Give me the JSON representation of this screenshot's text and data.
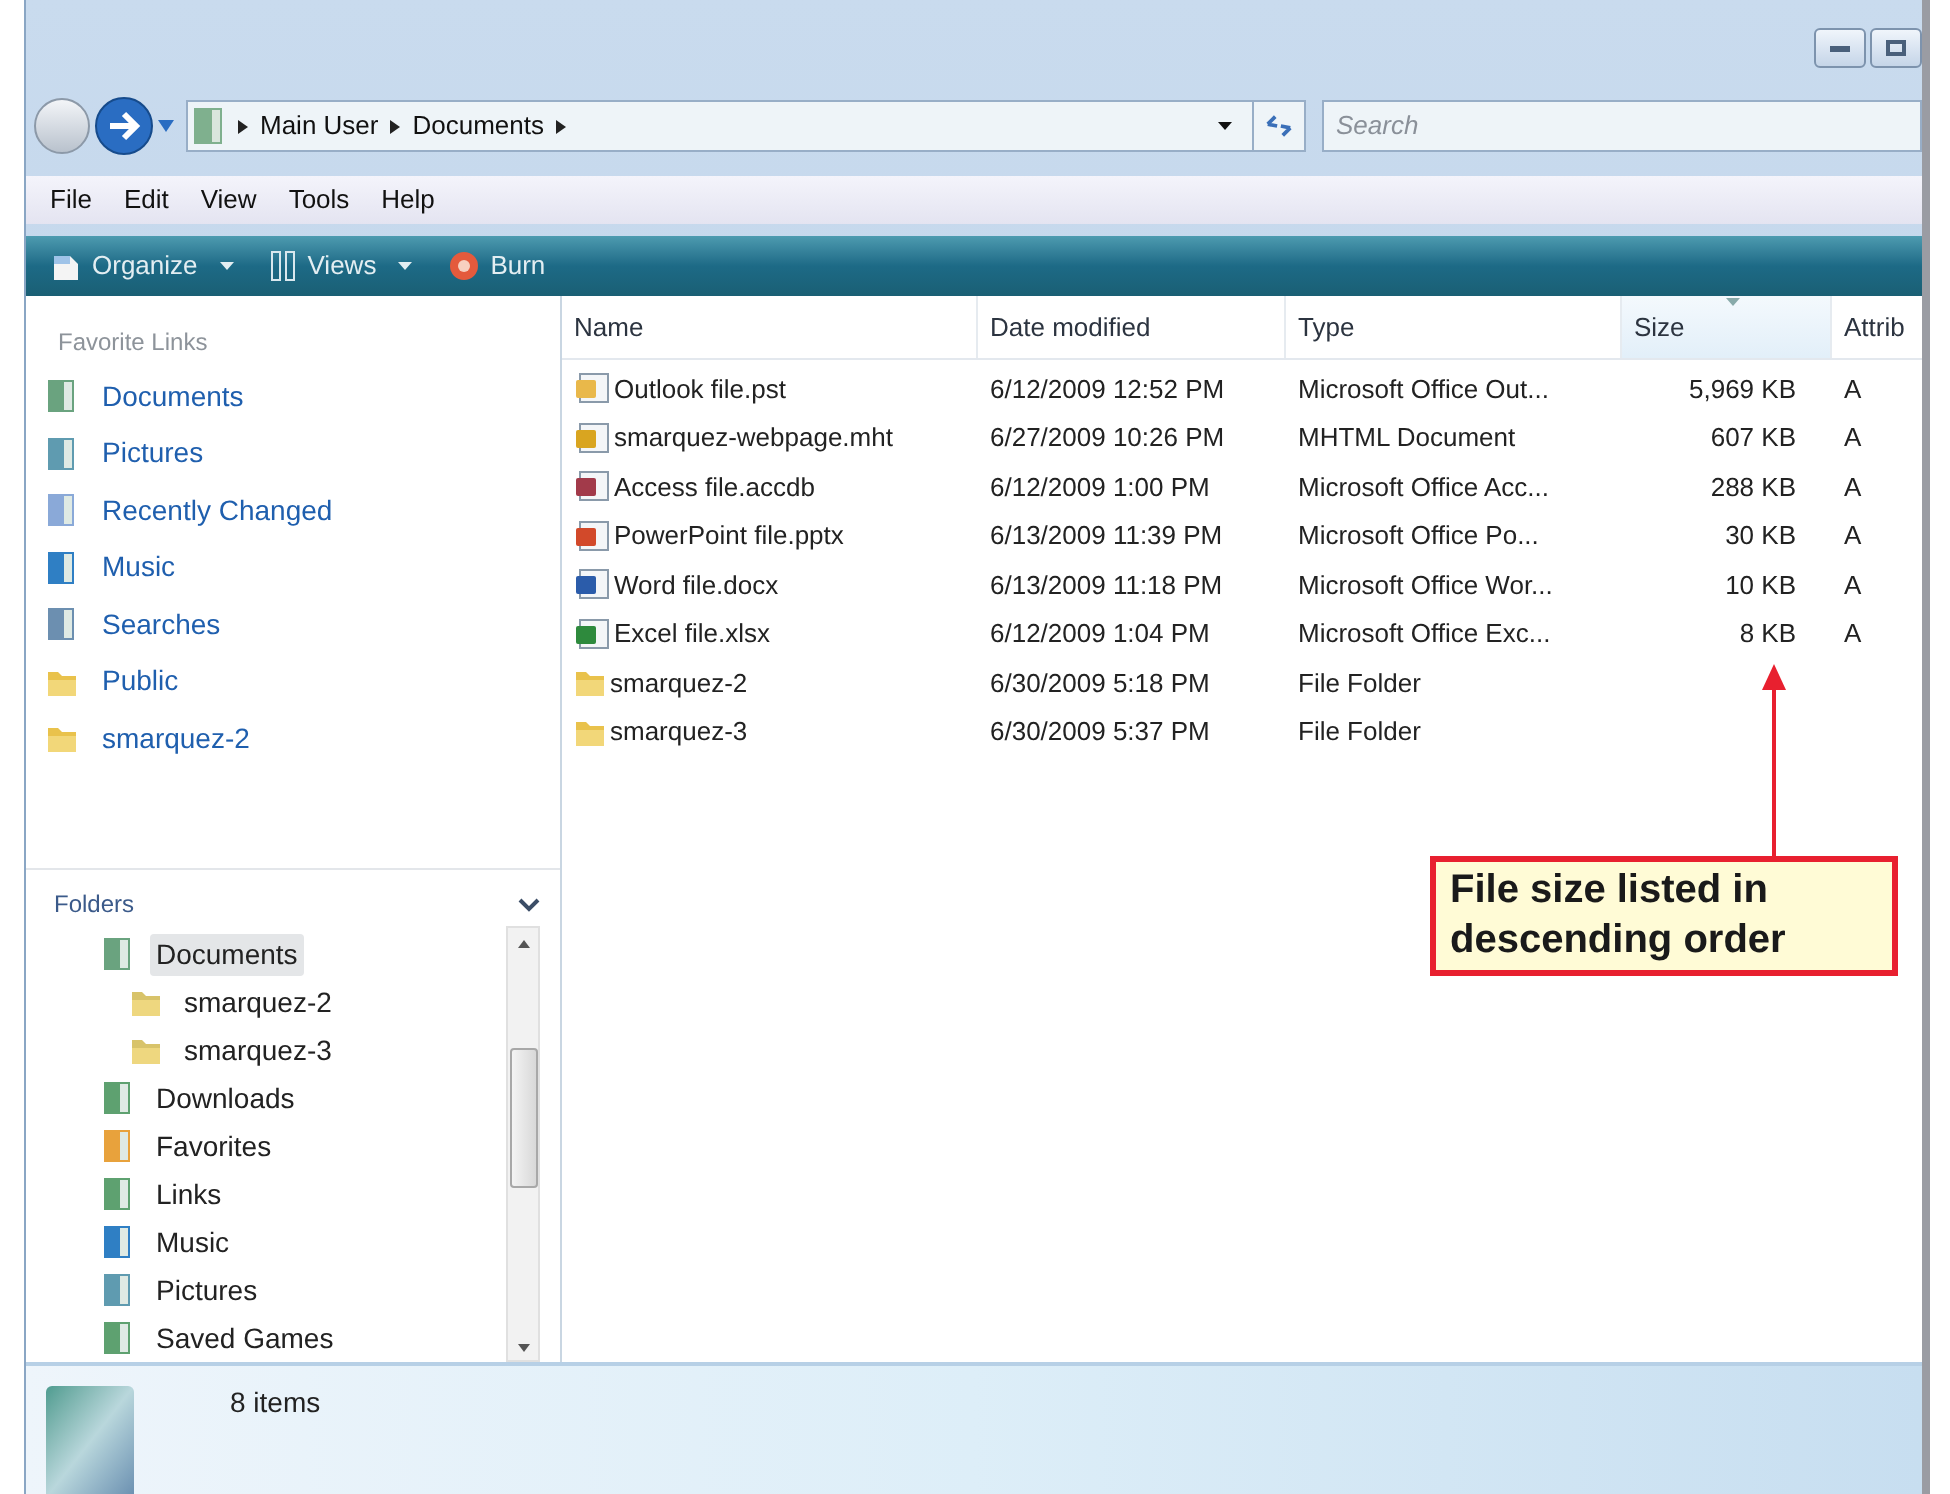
{
  "address_bar": {
    "path": [
      "Main User",
      "Documents"
    ],
    "search_placeholder": "Search"
  },
  "menu": [
    "File",
    "Edit",
    "View",
    "Tools",
    "Help"
  ],
  "toolbar": [
    {
      "label": "Organize",
      "kind": "organize",
      "dropdown": true
    },
    {
      "label": "Views",
      "kind": "views",
      "dropdown": true
    },
    {
      "label": "Burn",
      "kind": "burn",
      "dropdown": false
    }
  ],
  "favorite_links": {
    "title": "Favorite Links",
    "items": [
      {
        "label": "Documents",
        "kind": "documents"
      },
      {
        "label": "Pictures",
        "kind": "pictures"
      },
      {
        "label": "Recently Changed",
        "kind": "recent"
      },
      {
        "label": "Music",
        "kind": "music"
      },
      {
        "label": "Searches",
        "kind": "searches"
      },
      {
        "label": "Public",
        "kind": "folder"
      },
      {
        "label": "smarquez-2",
        "kind": "folder"
      }
    ]
  },
  "folders": {
    "title": "Folders",
    "tree": [
      {
        "label": "Documents",
        "kind": "documents",
        "selected": true,
        "children": [
          {
            "label": "smarquez-2",
            "kind": "userfolder",
            "selected": false
          },
          {
            "label": "smarquez-3",
            "kind": "userfolder",
            "selected": false
          }
        ]
      },
      {
        "label": "Downloads",
        "kind": "library",
        "selected": false
      },
      {
        "label": "Favorites",
        "kind": "favorites",
        "selected": false
      },
      {
        "label": "Links",
        "kind": "library",
        "selected": false
      },
      {
        "label": "Music",
        "kind": "music",
        "selected": false
      },
      {
        "label": "Pictures",
        "kind": "pictures",
        "selected": false
      },
      {
        "label": "Saved Games",
        "kind": "library",
        "selected": false
      }
    ]
  },
  "table": {
    "columns": [
      {
        "label": "Name",
        "selected": false
      },
      {
        "label": "Date modified",
        "selected": false
      },
      {
        "label": "Type",
        "selected": false
      },
      {
        "label": "Size",
        "selected": true
      },
      {
        "label": "Attrib",
        "selected": false
      }
    ],
    "rows": [
      {
        "kind": "pst",
        "name": "Outlook file.pst",
        "date": "6/12/2009 12:52 PM",
        "type": "Microsoft Office Out...",
        "size": "5,969 KB",
        "attrib": "A"
      },
      {
        "kind": "mht",
        "name": "smarquez-webpage.mht",
        "date": "6/27/2009 10:26 PM",
        "type": "MHTML Document",
        "size": "607 KB",
        "attrib": "A"
      },
      {
        "kind": "accdb",
        "name": "Access file.accdb",
        "date": "6/12/2009 1:00 PM",
        "type": "Microsoft Office Acc...",
        "size": "288 KB",
        "attrib": "A"
      },
      {
        "kind": "pptx",
        "name": "PowerPoint file.pptx",
        "date": "6/13/2009 11:39 PM",
        "type": "Microsoft Office Po...",
        "size": "30 KB",
        "attrib": "A"
      },
      {
        "kind": "docx",
        "name": "Word file.docx",
        "date": "6/13/2009 11:18 PM",
        "type": "Microsoft Office Wor...",
        "size": "10 KB",
        "attrib": "A"
      },
      {
        "kind": "xlsx",
        "name": "Excel file.xlsx",
        "date": "6/12/2009 1:04 PM",
        "type": "Microsoft Office Exc...",
        "size": "8 KB",
        "attrib": "A"
      },
      {
        "kind": "folder",
        "name": "smarquez-2",
        "date": "6/30/2009 5:18 PM",
        "type": "File Folder"
      },
      {
        "kind": "folder",
        "name": "smarquez-3",
        "date": "6/30/2009 5:37 PM",
        "type": "File Folder"
      }
    ]
  },
  "callout": "File size listed in descending order",
  "status_bar": {
    "item_count": "8 items"
  }
}
